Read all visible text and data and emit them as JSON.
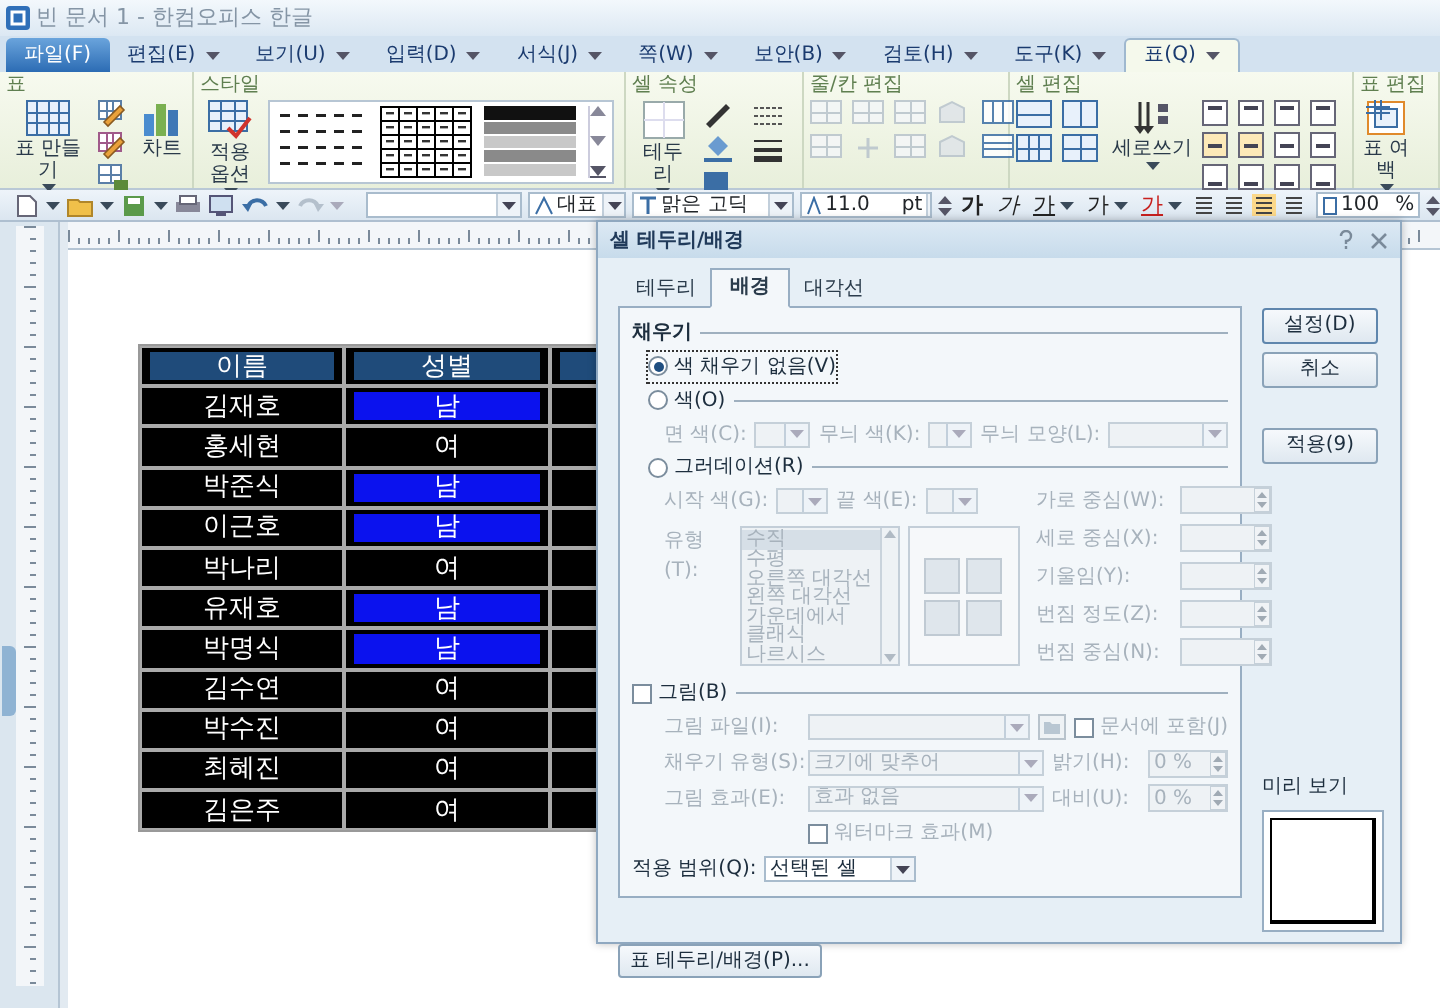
{
  "window": {
    "title": "빈 문서 1 - 한컴오피스 한글"
  },
  "menu": [
    {
      "label": "파일(F)",
      "kind": "file",
      "selected": false
    },
    {
      "label": "편집(E)",
      "kind": "tab",
      "selected": false
    },
    {
      "label": "보기(U)",
      "kind": "tab",
      "selected": false
    },
    {
      "label": "입력(D)",
      "kind": "tab",
      "selected": false
    },
    {
      "label": "서식(J)",
      "kind": "tab",
      "selected": false
    },
    {
      "label": "쪽(W)",
      "kind": "tab",
      "selected": false
    },
    {
      "label": "보안(B)",
      "kind": "tab",
      "selected": false
    },
    {
      "label": "검토(H)",
      "kind": "tab",
      "selected": false
    },
    {
      "label": "도구(K)",
      "kind": "tab",
      "selected": false
    },
    {
      "label": "표(Q)",
      "kind": "tab",
      "selected": true
    }
  ],
  "ribbon": [
    {
      "title": "표",
      "buttons": [
        {
          "label": "표 만들기",
          "menu": true
        },
        {
          "label": "차트",
          "menu": false
        }
      ]
    },
    {
      "title": "스타일",
      "buttons": [
        {
          "label": "적용 옵션",
          "menu": true
        }
      ]
    },
    {
      "title": "셀 속성",
      "buttons": [
        {
          "label": "테두리",
          "menu": true
        }
      ]
    },
    {
      "title": "줄/칸 편집"
    },
    {
      "title": "셀 편집",
      "buttons": [
        {
          "label": "세로쓰기",
          "menu": true
        }
      ]
    },
    {
      "title": "표 편집",
      "buttons": [
        {
          "label": "표 여백",
          "menu": true
        }
      ]
    }
  ],
  "toolbar": {
    "style": "대표",
    "font": "맑은 고딕",
    "size": "11.0",
    "size_unit": "pt",
    "format": [
      "가",
      "가",
      "가",
      "가",
      "가"
    ],
    "zoom": "100",
    "zoom_unit": "%"
  },
  "table": {
    "columns": [
      "이름",
      "성별"
    ],
    "rows": [
      {
        "cells": [
          "김재호",
          "남"
        ],
        "highlighted": true
      },
      {
        "cells": [
          "홍세현",
          "여"
        ],
        "highlighted": false
      },
      {
        "cells": [
          "박준식",
          "남"
        ],
        "highlighted": true
      },
      {
        "cells": [
          "이근호",
          "남"
        ],
        "highlighted": true
      },
      {
        "cells": [
          "박나리",
          "여"
        ],
        "highlighted": false
      },
      {
        "cells": [
          "유재호",
          "남"
        ],
        "highlighted": true
      },
      {
        "cells": [
          "박명식",
          "남"
        ],
        "highlighted": true
      },
      {
        "cells": [
          "김수연",
          "여"
        ],
        "highlighted": false
      },
      {
        "cells": [
          "박수진",
          "여"
        ],
        "highlighted": false
      },
      {
        "cells": [
          "최혜진",
          "여"
        ],
        "highlighted": false
      },
      {
        "cells": [
          "김은주",
          "여"
        ],
        "highlighted": false
      }
    ]
  },
  "dialog": {
    "title": "셀 테두리/배경",
    "tabs": [
      {
        "label": "테두리",
        "selected": false
      },
      {
        "label": "배경",
        "selected": true
      },
      {
        "label": "대각선",
        "selected": false
      }
    ],
    "fill": {
      "title": "채우기",
      "options": [
        {
          "label": "색 채우기 없음(V)",
          "selected": true
        },
        {
          "label": "색(O)",
          "selected": false
        },
        {
          "label": "그러데이션(R)",
          "selected": false
        }
      ]
    },
    "color_fields": [
      "면 색(C):",
      "무늬 색(K):",
      "무늬 모양(L):"
    ],
    "gradient": {
      "start": "시작 색(G):",
      "end": "끝 색(E):",
      "type": "유형(T):",
      "types": [
        {
          "label": "수직",
          "selected": true
        },
        {
          "label": "수평",
          "selected": false
        },
        {
          "label": "오른쪽 대각선",
          "selected": false
        },
        {
          "label": "왼쪽 대각선",
          "selected": false
        },
        {
          "label": "가운데에서",
          "selected": false
        },
        {
          "label": "클래식",
          "selected": false
        },
        {
          "label": "나르시스",
          "selected": false
        }
      ],
      "spins": [
        "가로 중심(W):",
        "세로 중심(X):",
        "기울임(Y):",
        "번짐 정도(Z):",
        "번짐 중심(N):"
      ]
    },
    "picture": {
      "label": "그림(B)",
      "checked": false,
      "file": "그림 파일(I):",
      "embed": {
        "label": "문서에 포함(J)",
        "checked": false
      },
      "fill_type": {
        "label": "채우기 유형(S):",
        "value": "크기에 맞추어"
      },
      "brightness": {
        "label": "밝기(H):",
        "value": "0 %"
      },
      "effect": {
        "label": "그림 효과(E):",
        "value": "효과 없음"
      },
      "contrast": {
        "label": "대비(U):",
        "value": "0 %"
      },
      "watermark": {
        "label": "워터마크 효과(M)",
        "checked": false
      }
    },
    "scope": {
      "label": "적용 범위(Q):",
      "value": "선택된 셀"
    },
    "buttons": [
      "설정(D)",
      "취소",
      "적용(9)"
    ],
    "preview": {
      "label": "미리 보기"
    },
    "footer_button": "표 테두리/배경(P)..."
  }
}
